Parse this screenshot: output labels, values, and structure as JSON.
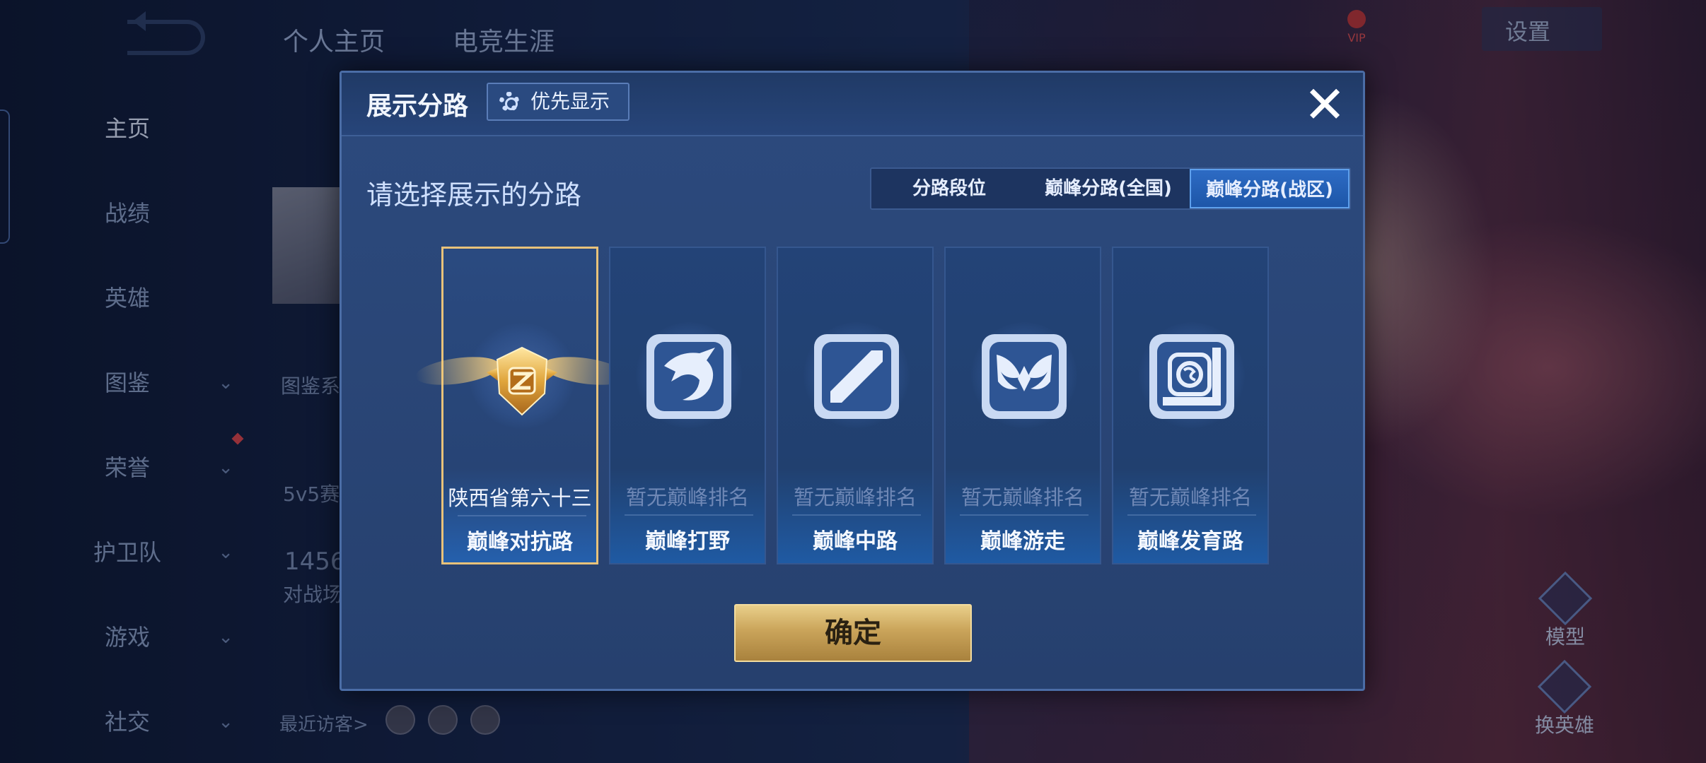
{
  "background": {
    "top_tabs": [
      "个人主页",
      "电竞生涯"
    ],
    "nav_items": [
      {
        "label": "主页",
        "has_chevron": false
      },
      {
        "label": "战绩",
        "has_chevron": false
      },
      {
        "label": "英雄",
        "has_chevron": false
      },
      {
        "label": "图鉴",
        "has_chevron": true
      },
      {
        "label": "荣誉",
        "has_chevron": true
      },
      {
        "label": "护卫队",
        "has_chevron": true
      },
      {
        "label": "游戏",
        "has_chevron": true
      },
      {
        "label": "社交",
        "has_chevron": true
      }
    ],
    "settings_label": "设置",
    "vip_label": "VIP",
    "profile_snippets": {
      "tujian": "图鉴系",
      "match": "5v5赛",
      "count": "1456",
      "count_label": "对战场",
      "recent_visitors": "最近访客>"
    },
    "right_buttons": {
      "model": "模型",
      "swap_hero": "换英雄"
    }
  },
  "dialog": {
    "title": "展示分路",
    "priority_button": "优先显示",
    "subtitle": "请选择展示的分路",
    "tabs": [
      {
        "label": "分路段位",
        "active": false
      },
      {
        "label": "巅峰分路(全国)",
        "active": false
      },
      {
        "label": "巅峰分路(战区)",
        "active": true
      }
    ],
    "cards": [
      {
        "rank": "陕西省第六十三",
        "lane": "巅峰对抗路",
        "icon": "gold-rank-medal-icon",
        "selected": true
      },
      {
        "rank": "暂无巅峰排名",
        "lane": "巅峰打野",
        "icon": "dragon-jungle-icon",
        "selected": false
      },
      {
        "rank": "暂无巅峰排名",
        "lane": "巅峰中路",
        "icon": "slash-midlane-icon",
        "selected": false
      },
      {
        "rank": "暂无巅峰排名",
        "lane": "巅峰游走",
        "icon": "wings-support-icon",
        "selected": false
      },
      {
        "rank": "暂无巅峰排名",
        "lane": "巅峰发育路",
        "icon": "ring-marksman-icon",
        "selected": false
      }
    ],
    "confirm_button": "确定"
  },
  "colors": {
    "dialog_bg": "#2a4677",
    "selected_border": "#e8c27a",
    "active_tab": "#1d56a8",
    "confirm_gold": "#caa45a"
  }
}
